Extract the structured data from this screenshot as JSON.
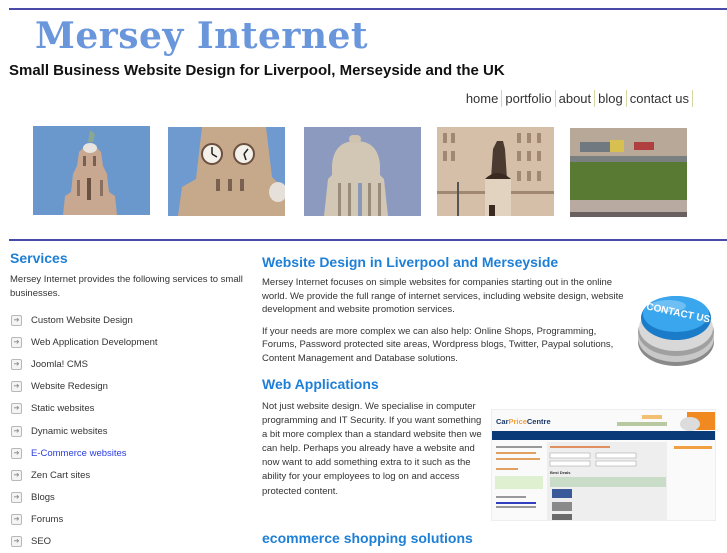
{
  "header": {
    "site_title": "Mersey Internet",
    "tagline": "Small Business Website Design for Liverpool, Merseyside and the UK"
  },
  "nav": {
    "items": [
      {
        "label": "home"
      },
      {
        "label": "portfolio"
      },
      {
        "label": "about"
      },
      {
        "label": "blog"
      },
      {
        "label": "contact us"
      }
    ]
  },
  "photos": [
    {
      "subject": "Liver Building tower with Liver Bird"
    },
    {
      "subject": "Liver Building clock tower"
    },
    {
      "subject": "Port of Liverpool Building dome"
    },
    {
      "subject": "Statue in front of building"
    },
    {
      "subject": "Pier Head lawn"
    }
  ],
  "sidebar": {
    "heading": "Services",
    "intro": "Mersey Internet provides the following services to small businesses.",
    "items": [
      {
        "label": "Custom Website Design"
      },
      {
        "label": "Web Application Development"
      },
      {
        "label": "Joomla! CMS"
      },
      {
        "label": "Website Redesign"
      },
      {
        "label": "Static websites"
      },
      {
        "label": "Dynamic websites"
      },
      {
        "label": "E-Commerce websites"
      },
      {
        "label": "Zen Cart sites"
      },
      {
        "label": "Blogs"
      },
      {
        "label": "Forums"
      },
      {
        "label": "SEO"
      }
    ],
    "active_item": "E-Commerce websites"
  },
  "main": {
    "section1": {
      "heading": "Website Design in Liverpool and Merseyside",
      "para1": "Mersey Internet focuses on simple websites for companies starting out in the online world. We provide the full range of internet services, including website design, website development and website promotion services.",
      "para2": "If your needs are more complex we can also help: Online Shops, Programming, Forums, Password protected site areas, Wordpress blogs, Twitter, Paypal solutions, Content Management and Database solutions."
    },
    "contact_button_label": "CONTACT US",
    "section2": {
      "heading": "Web Applications",
      "para": "Not just website design. We specialise in computer programming and IT Security. If you want something a bit more complex than a standard website then we can help. Perhaps you already have a website and now want to add something extra to it such as the ability for your employees to log on and access protected content."
    },
    "screenshot": {
      "brand_part1": "Car",
      "brand_part2": "Price",
      "brand_part3": "Centre",
      "table_title": "Best Deals"
    },
    "section3": {
      "heading": "ecommerce shopping solutions"
    }
  },
  "colors": {
    "title": "#6a96dc",
    "heading": "#1e7fd6",
    "rule": "#4a4aa8",
    "active_link": "#2b3de0"
  }
}
